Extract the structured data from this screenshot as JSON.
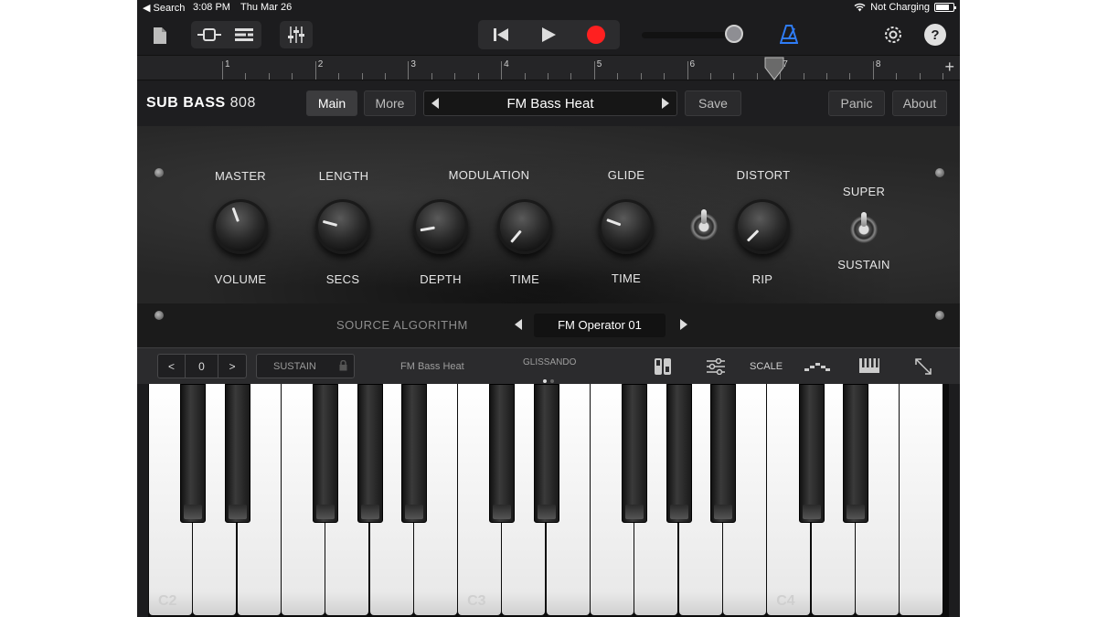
{
  "status_bar": {
    "back_label": "◀ Search",
    "time": "3:08 PM",
    "date": "Thu Mar 26",
    "charging": "Not Charging"
  },
  "control_bar": {
    "icons": [
      "document-icon",
      "view-toggle-icon",
      "tracks-icon",
      "mixer-icon",
      "rewind-icon",
      "play-icon",
      "record-icon",
      "metronome-icon",
      "settings-icon",
      "help-icon"
    ],
    "record_color": "#ff2020",
    "metronome_color": "#2f7cf6",
    "help_label": "?",
    "volume_level": 0.9
  },
  "ruler": {
    "bars": [
      "1",
      "2",
      "3",
      "4",
      "5",
      "6",
      "7",
      "8"
    ],
    "playhead_bar": "7",
    "add_label": "+"
  },
  "header": {
    "plugin_name_bold": "SUB BASS",
    "plugin_name_num": "808",
    "main_label": "Main",
    "more_label": "More",
    "preset_name": "FM Bass Heat",
    "save_label": "Save",
    "panic_label": "Panic",
    "about_label": "About"
  },
  "panel": {
    "top_labels": {
      "master": "MASTER",
      "length": "LENGTH",
      "modulation": "MODULATION",
      "glide": "GLIDE",
      "distort": "DISTORT",
      "super": "SUPER"
    },
    "bottom_labels": {
      "volume": "VOLUME",
      "secs": "SECS",
      "depth": "DEPTH",
      "time_mod": "TIME",
      "time_glide": "TIME",
      "rip": "RIP",
      "sustain": "SUSTAIN"
    },
    "source_algorithm_label": "SOURCE ALGORITHM",
    "source_algorithm_value": "FM Operator 01"
  },
  "keyboard_bar": {
    "octave_prev": "<",
    "octave_value": "0",
    "octave_next": ">",
    "sustain_label": "SUSTAIN",
    "preset_label": "FM Bass Heat",
    "glissando_label": "GLISSANDO",
    "scale_label": "SCALE"
  },
  "keyboard": {
    "octave_labels": [
      "C2",
      "C3",
      "C4"
    ]
  }
}
